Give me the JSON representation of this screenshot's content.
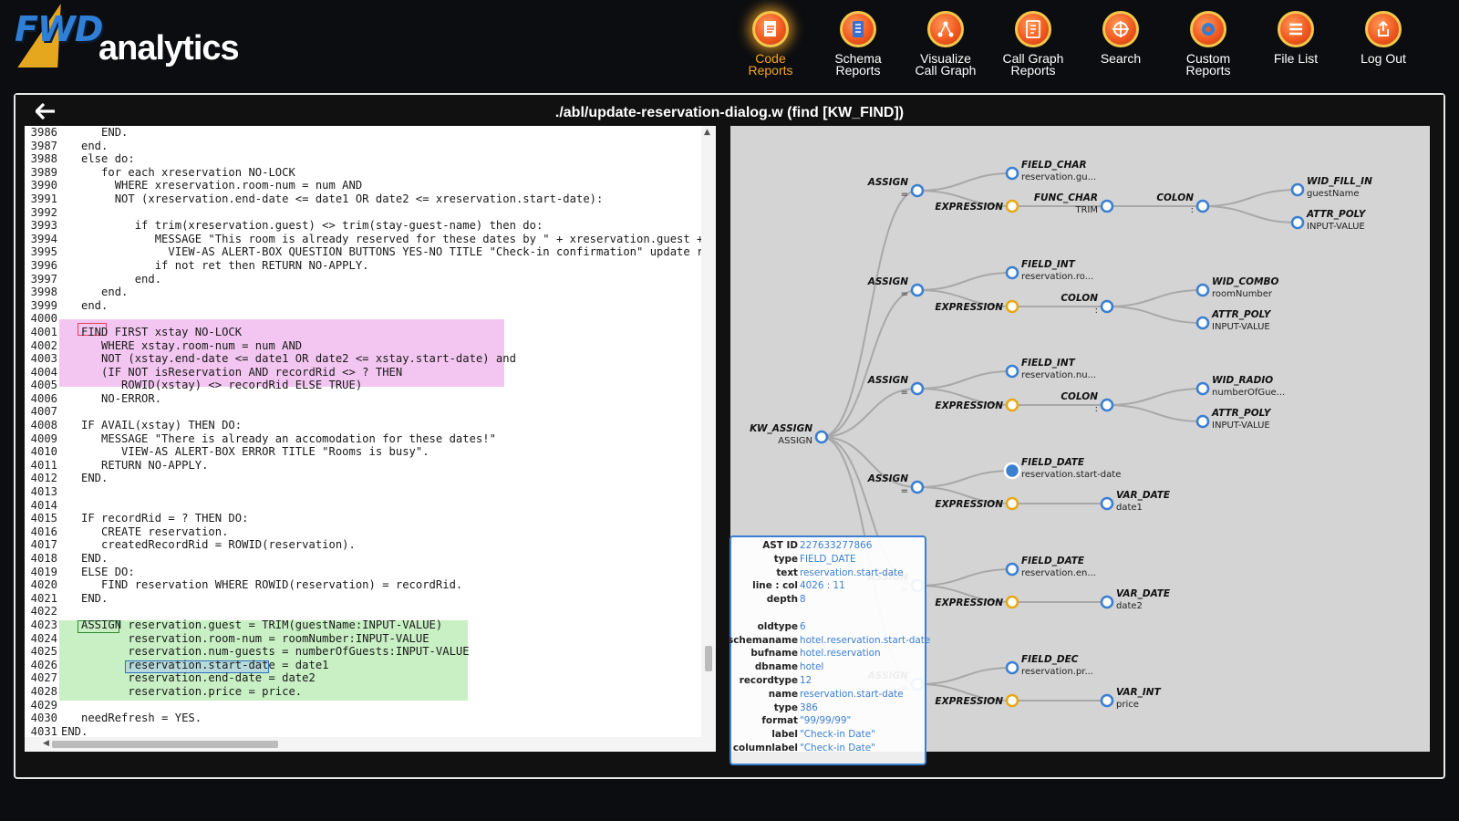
{
  "brand": {
    "logo_fwd": "FWD",
    "logo_product": "analytics"
  },
  "nav": [
    {
      "label": "Code\nReports",
      "icon": "document-icon",
      "active": true
    },
    {
      "label": "Schema\nReports",
      "icon": "schema-icon"
    },
    {
      "label": "Visualize\nCall Graph",
      "icon": "graph-icon"
    },
    {
      "label": "Call Graph\nReports",
      "icon": "call-graph-report-icon"
    },
    {
      "label": "Search",
      "icon": "crosshair-icon"
    },
    {
      "label": "Custom\nReports",
      "icon": "gear-icon"
    },
    {
      "label": "File List",
      "icon": "list-icon"
    },
    {
      "label": "Log Out",
      "icon": "logout-icon"
    }
  ],
  "colors": {
    "accent": "#f5a623",
    "node_blue": "#3b7fd1",
    "node_gold": "#e6a817",
    "highlight_pink": "#f3c6f1",
    "highlight_green": "#c8f0c4"
  },
  "file_title": "./abl/update-reservation-dialog.w (find [KW_FIND])",
  "code": [
    {
      "n": "3986",
      "t": "      END."
    },
    {
      "n": "3987",
      "t": "   end."
    },
    {
      "n": "3988",
      "t": "   else do:"
    },
    {
      "n": "3989",
      "t": "      for each xreservation NO-LOCK"
    },
    {
      "n": "3990",
      "t": "        WHERE xreservation.room-num = num AND"
    },
    {
      "n": "3991",
      "t": "        NOT (xreservation.end-date <= date1 OR date2 <= xreservation.start-date):"
    },
    {
      "n": "3992",
      "t": ""
    },
    {
      "n": "3993",
      "t": "           if trim(xreservation.guest) <> trim(stay-guest-name) then do:"
    },
    {
      "n": "3994",
      "t": "              MESSAGE \"This room is already reserved for these dates by \" + xreservation.guest + \"!"
    },
    {
      "n": "3995",
      "t": "                VIEW-AS ALERT-BOX QUESTION BUTTONS YES-NO TITLE \"Check-in confirmation\" update ret"
    },
    {
      "n": "3996",
      "t": "              if not ret then RETURN NO-APPLY."
    },
    {
      "n": "3997",
      "t": "           end."
    },
    {
      "n": "3998",
      "t": "      end."
    },
    {
      "n": "3999",
      "t": "   end."
    },
    {
      "n": "4000",
      "t": ""
    },
    {
      "n": "4001",
      "t": "   FIND FIRST xstay NO-LOCK"
    },
    {
      "n": "4002",
      "t": "      WHERE xstay.room-num = num AND"
    },
    {
      "n": "4003",
      "t": "      NOT (xstay.end-date <= date1 OR date2 <= xstay.start-date) and"
    },
    {
      "n": "4004",
      "t": "      (IF NOT isReservation AND recordRid <> ? THEN"
    },
    {
      "n": "4005",
      "t": "         ROWID(xstay) <> recordRid ELSE TRUE)"
    },
    {
      "n": "4006",
      "t": "      NO-ERROR."
    },
    {
      "n": "4007",
      "t": ""
    },
    {
      "n": "4008",
      "t": "   IF AVAIL(xstay) THEN DO:"
    },
    {
      "n": "4009",
      "t": "      MESSAGE \"There is already an accomodation for these dates!\""
    },
    {
      "n": "4010",
      "t": "         VIEW-AS ALERT-BOX ERROR TITLE \"Rooms is busy\"."
    },
    {
      "n": "4011",
      "t": "      RETURN NO-APPLY."
    },
    {
      "n": "4012",
      "t": "   END."
    },
    {
      "n": "4013",
      "t": ""
    },
    {
      "n": "4014",
      "t": ""
    },
    {
      "n": "4015",
      "t": "   IF recordRid = ? THEN DO:"
    },
    {
      "n": "4016",
      "t": "      CREATE reservation."
    },
    {
      "n": "4017",
      "t": "      createdRecordRid = ROWID(reservation)."
    },
    {
      "n": "4018",
      "t": "   END."
    },
    {
      "n": "4019",
      "t": "   ELSE DO:"
    },
    {
      "n": "4020",
      "t": "      FIND reservation WHERE ROWID(reservation) = recordRid."
    },
    {
      "n": "4021",
      "t": "   END."
    },
    {
      "n": "4022",
      "t": ""
    },
    {
      "n": "4023",
      "t": "   ASSIGN reservation.guest = TRIM(guestName:INPUT-VALUE)"
    },
    {
      "n": "4024",
      "t": "          reservation.room-num = roomNumber:INPUT-VALUE"
    },
    {
      "n": "4025",
      "t": "          reservation.num-guests = numberOfGuests:INPUT-VALUE"
    },
    {
      "n": "4026",
      "t": "          reservation.start-date = date1"
    },
    {
      "n": "4027",
      "t": "          reservation.end-date = date2"
    },
    {
      "n": "4028",
      "t": "          reservation.price = price."
    },
    {
      "n": "4029",
      "t": ""
    },
    {
      "n": "4030",
      "t": "   needRefresh = YES."
    },
    {
      "n": "4031",
      "t": "END."
    }
  ],
  "graph": {
    "nodes": [
      {
        "id": "root",
        "label": "KW_ASSIGN",
        "sub": "ASSIGN",
        "style": "blue"
      },
      {
        "id": "a1",
        "label": "ASSIGN",
        "sub": "=",
        "style": "blue"
      },
      {
        "id": "a1f",
        "label": "FIELD_CHAR",
        "sub": "reservation.gu...",
        "style": "blue"
      },
      {
        "id": "a1e",
        "label": "EXPRESSION",
        "sub": "",
        "style": "gold"
      },
      {
        "id": "a1fc",
        "label": "FUNC_CHAR",
        "sub": "TRIM",
        "style": "blue"
      },
      {
        "id": "a1c",
        "label": "COLON",
        "sub": ":",
        "style": "blue"
      },
      {
        "id": "a1w",
        "label": "WID_FILL_IN",
        "sub": "guestName",
        "style": "blue"
      },
      {
        "id": "a1p",
        "label": "ATTR_POLY",
        "sub": "INPUT-VALUE",
        "style": "blue"
      },
      {
        "id": "a2",
        "label": "ASSIGN",
        "sub": "=",
        "style": "blue"
      },
      {
        "id": "a2f",
        "label": "FIELD_INT",
        "sub": "reservation.ro...",
        "style": "blue"
      },
      {
        "id": "a2e",
        "label": "EXPRESSION",
        "sub": "",
        "style": "gold"
      },
      {
        "id": "a2c",
        "label": "COLON",
        "sub": ":",
        "style": "blue"
      },
      {
        "id": "a2w",
        "label": "WID_COMBO",
        "sub": "roomNumber",
        "style": "blue"
      },
      {
        "id": "a2p",
        "label": "ATTR_POLY",
        "sub": "INPUT-VALUE",
        "style": "blue"
      },
      {
        "id": "a3",
        "label": "ASSIGN",
        "sub": "=",
        "style": "blue"
      },
      {
        "id": "a3f",
        "label": "FIELD_INT",
        "sub": "reservation.nu...",
        "style": "blue"
      },
      {
        "id": "a3e",
        "label": "EXPRESSION",
        "sub": "",
        "style": "gold"
      },
      {
        "id": "a3c",
        "label": "COLON",
        "sub": ":",
        "style": "blue"
      },
      {
        "id": "a3w",
        "label": "WID_RADIO",
        "sub": "numberOfGue...",
        "style": "blue"
      },
      {
        "id": "a3p",
        "label": "ATTR_POLY",
        "sub": "INPUT-VALUE",
        "style": "blue"
      },
      {
        "id": "a4",
        "label": "ASSIGN",
        "sub": "=",
        "style": "blue"
      },
      {
        "id": "a4f",
        "label": "FIELD_DATE",
        "sub": "reservation.start-date",
        "style": "selected"
      },
      {
        "id": "a4e",
        "label": "EXPRESSION",
        "sub": "",
        "style": "gold"
      },
      {
        "id": "a4v",
        "label": "VAR_DATE",
        "sub": "date1",
        "style": "blue"
      },
      {
        "id": "a5",
        "label": "ASSIGN",
        "sub": "=",
        "style": "blue"
      },
      {
        "id": "a5f",
        "label": "FIELD_DATE",
        "sub": "reservation.en...",
        "style": "blue"
      },
      {
        "id": "a5e",
        "label": "EXPRESSION",
        "sub": "",
        "style": "gold"
      },
      {
        "id": "a5v",
        "label": "VAR_DATE",
        "sub": "date2",
        "style": "blue"
      },
      {
        "id": "a6",
        "label": "ASSIGN",
        "sub": "=",
        "style": "blue"
      },
      {
        "id": "a6f",
        "label": "FIELD_DEC",
        "sub": "reservation.pr...",
        "style": "blue"
      },
      {
        "id": "a6e",
        "label": "EXPRESSION",
        "sub": "",
        "style": "gold"
      },
      {
        "id": "a6v",
        "label": "VAR_INT",
        "sub": "price",
        "style": "blue"
      }
    ],
    "edges": [
      [
        "root",
        "a1"
      ],
      [
        "root",
        "a2"
      ],
      [
        "root",
        "a3"
      ],
      [
        "root",
        "a4"
      ],
      [
        "root",
        "a5"
      ],
      [
        "root",
        "a6"
      ],
      [
        "a1",
        "a1f"
      ],
      [
        "a1",
        "a1e"
      ],
      [
        "a1e",
        "a1fc"
      ],
      [
        "a1fc",
        "a1c"
      ],
      [
        "a1c",
        "a1w"
      ],
      [
        "a1c",
        "a1p"
      ],
      [
        "a2",
        "a2f"
      ],
      [
        "a2",
        "a2e"
      ],
      [
        "a2e",
        "a2c"
      ],
      [
        "a2c",
        "a2w"
      ],
      [
        "a2c",
        "a2p"
      ],
      [
        "a3",
        "a3f"
      ],
      [
        "a3",
        "a3e"
      ],
      [
        "a3e",
        "a3c"
      ],
      [
        "a3c",
        "a3w"
      ],
      [
        "a3c",
        "a3p"
      ],
      [
        "a4",
        "a4f"
      ],
      [
        "a4",
        "a4e"
      ],
      [
        "a4e",
        "a4v"
      ],
      [
        "a5",
        "a5f"
      ],
      [
        "a5",
        "a5e"
      ],
      [
        "a5e",
        "a5v"
      ],
      [
        "a6",
        "a6f"
      ],
      [
        "a6",
        "a6e"
      ],
      [
        "a6e",
        "a6v"
      ]
    ]
  },
  "tooltip": [
    {
      "k": "AST ID",
      "v": "227633277866"
    },
    {
      "k": "type",
      "v": "FIELD_DATE"
    },
    {
      "k": "text",
      "v": "reservation.start-date"
    },
    {
      "k": "line : col",
      "v": "4026 : 11"
    },
    {
      "k": "depth",
      "v": "8"
    },
    {
      "k": "",
      "v": ""
    },
    {
      "k": "oldtype",
      "v": "6"
    },
    {
      "k": "schemaname",
      "v": "hotel.reservation.start-date"
    },
    {
      "k": "bufname",
      "v": "hotel.reservation"
    },
    {
      "k": "dbname",
      "v": "hotel"
    },
    {
      "k": "recordtype",
      "v": "12"
    },
    {
      "k": "name",
      "v": "reservation.start-date"
    },
    {
      "k": "type",
      "v": "386"
    },
    {
      "k": "format",
      "v": "\"99/99/99\""
    },
    {
      "k": "label",
      "v": "\"Check-in Date\""
    },
    {
      "k": "columnlabel",
      "v": "\"Check-in Date\""
    }
  ]
}
